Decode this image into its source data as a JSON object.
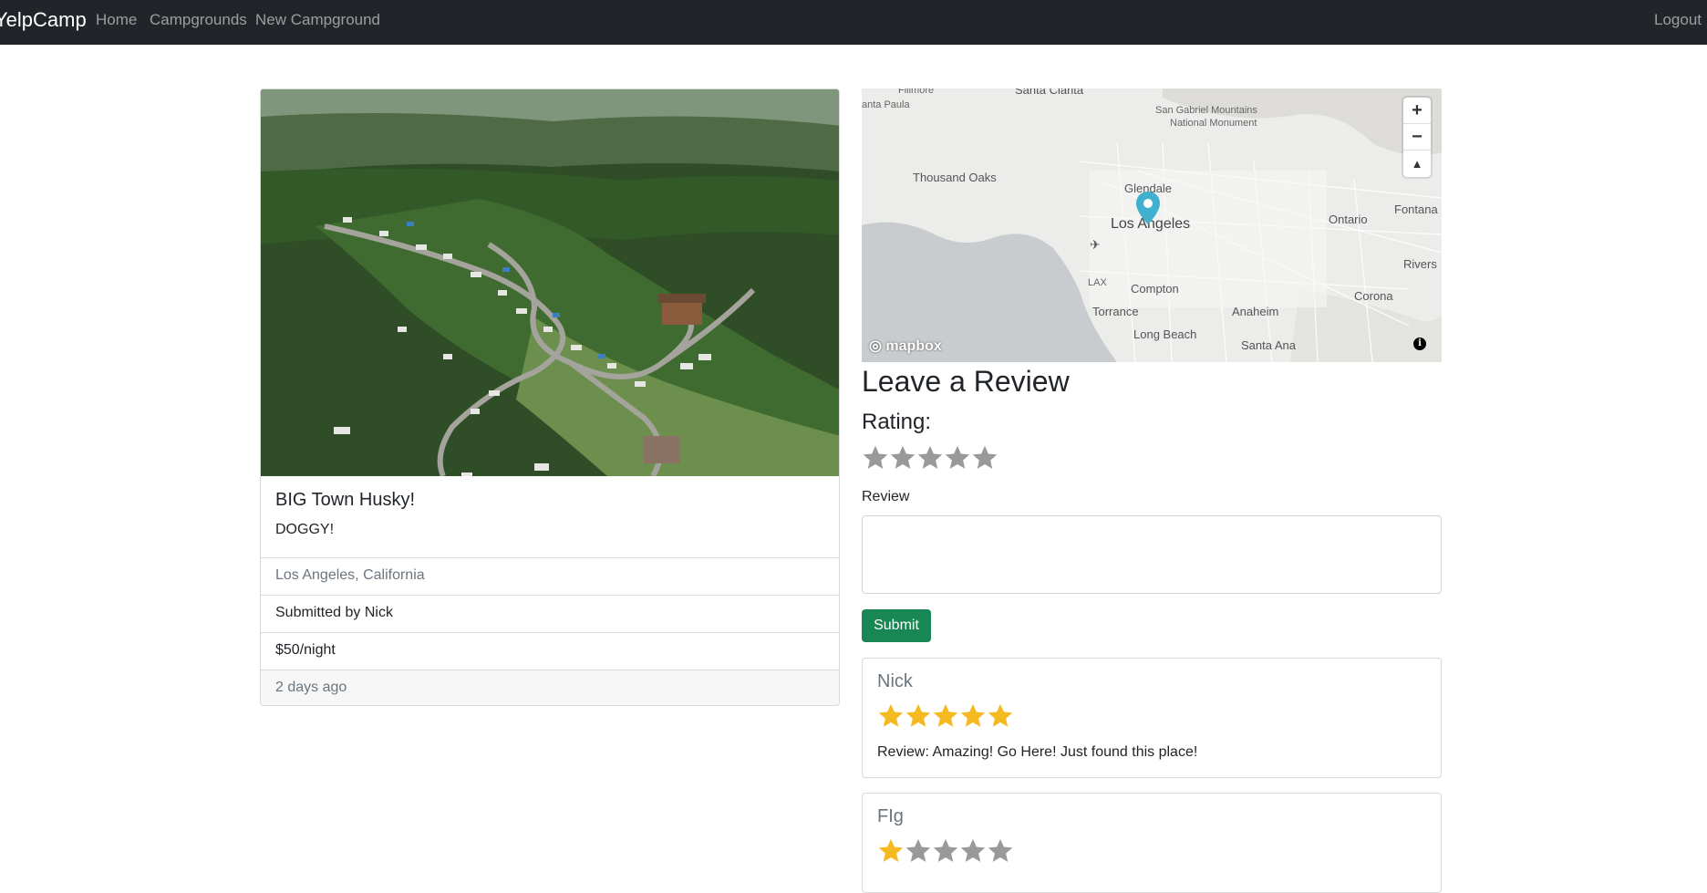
{
  "navbar": {
    "brand": "YelpCamp",
    "links": [
      "Home",
      "Campgrounds",
      "New Campground"
    ],
    "logout": "Logout"
  },
  "campground": {
    "title": "BIG Town Husky!",
    "description": "DOGGY!",
    "location": "Los Angeles, California",
    "submitted_by": "Submitted by Nick",
    "price": "$50/night",
    "posted": "2 days ago"
  },
  "map": {
    "labels": {
      "santa_clarita": "Santa Clarita",
      "santa_paula": "anta Paula",
      "fillmore": "Fillmore",
      "san_gabriel": "San Gabriel Mountains",
      "national_monument": "National Monument",
      "thousand_oaks": "Thousand Oaks",
      "glendale": "Glendale",
      "los_angeles": "Los Angeles",
      "ontario": "Ontario",
      "fontana": "Fontana",
      "lax": "LAX",
      "compton": "Compton",
      "riverside": "Rivers",
      "corona": "Corona",
      "torrance": "Torrance",
      "anaheim": "Anaheim",
      "long_beach": "Long Beach",
      "santa_ana": "Santa Ana"
    },
    "zoom_in": "+",
    "zoom_out": "−",
    "compass": "▲",
    "attribution": "mapbox",
    "info": "i",
    "colors": {
      "water": "#c9ccce",
      "land": "#ececea",
      "pin": "#3fb1ce"
    }
  },
  "review_form": {
    "heading": "Leave a Review",
    "rating_label": "Rating:",
    "rating_value": 0,
    "rating_max": 5,
    "review_label": "Review",
    "review_value": "",
    "submit_label": "Submit"
  },
  "reviews": [
    {
      "author": "Nick",
      "rating": 5,
      "text": "Review: Amazing! Go Here! Just found this place!"
    },
    {
      "author": "FIg",
      "rating": 1,
      "text": ""
    }
  ],
  "colors": {
    "star_filled": "#f5b921",
    "star_empty": "#999999",
    "success": "#198754"
  }
}
